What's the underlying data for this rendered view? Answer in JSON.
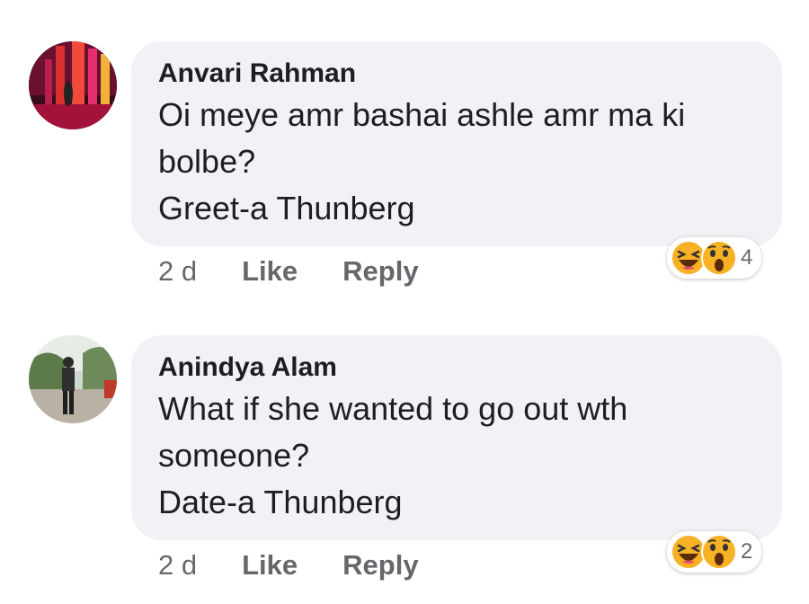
{
  "comments": [
    {
      "author": "Anvari Rahman",
      "lines": [
        "Oi meye amr bashai ashle amr ma ki",
        "bolbe?",
        "Greet-a Thunberg"
      ],
      "time": "2 d",
      "like_label": "Like",
      "reply_label": "Reply",
      "reaction_icons": [
        "laughing-emoji-icon",
        "wow-emoji-icon"
      ],
      "reaction_count": "4"
    },
    {
      "author": "Anindya Alam",
      "lines": [
        "What if she wanted to go out wth",
        "someone?",
        "Date-a Thunberg"
      ],
      "time": "2 d",
      "like_label": "Like",
      "reply_label": "Reply",
      "reaction_icons": [
        "laughing-emoji-icon",
        "wow-emoji-icon"
      ],
      "reaction_count": "2"
    }
  ],
  "colors": {
    "bubble": "#f0f2f5",
    "text": "#1c1e21",
    "meta": "#65676b",
    "emoji_yellow": "#f7b125"
  }
}
